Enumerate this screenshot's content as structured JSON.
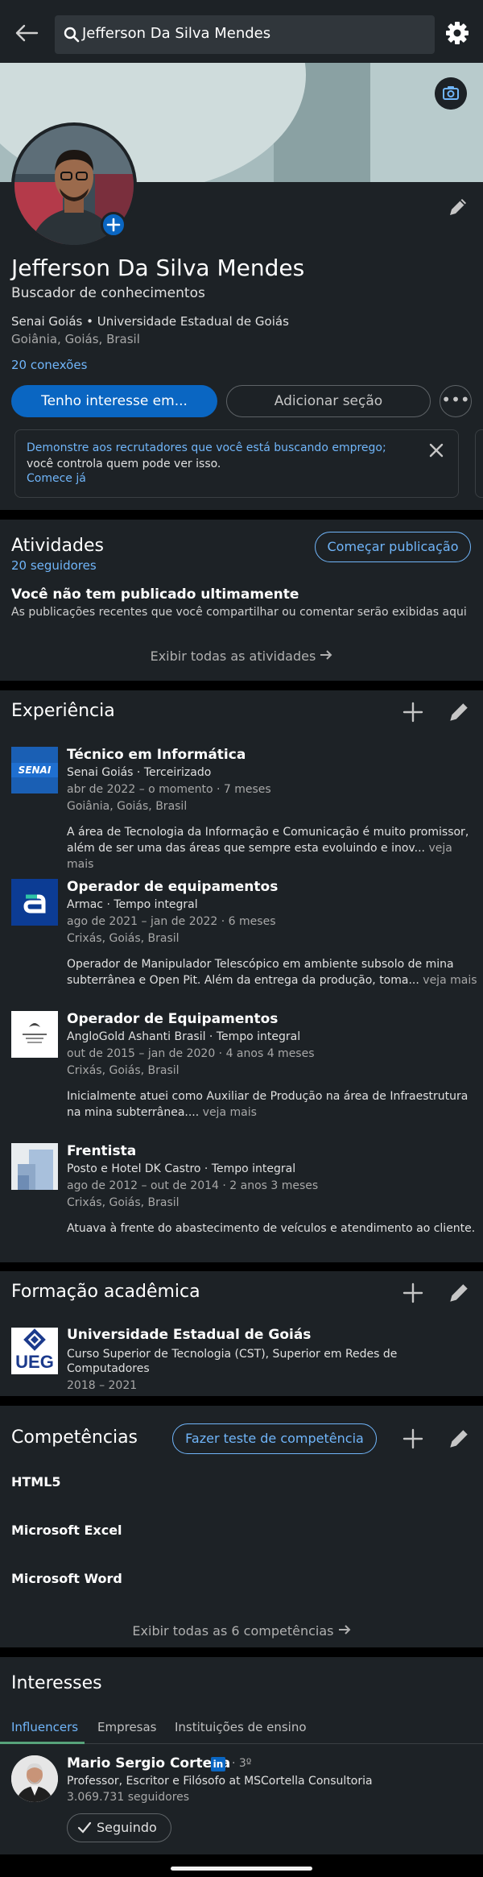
{
  "search": {
    "query": "Jefferson Da Silva Mendes"
  },
  "profile": {
    "name": "Jefferson Da Silva Mendes",
    "headline": "Buscador de conhecimentos",
    "education_line": "Senai Goiás • Universidade Estadual de Goiás",
    "location": "Goiânia, Goiás, Brasil",
    "connections": "20 conexões",
    "open_button": "Tenho interesse em...",
    "add_section_button": "Adicionar seção",
    "more_button": "•••",
    "notice": {
      "text_highlight": "Demonstre aos recrutadores que você está buscando emprego;",
      "text_rest": "você controla quem pode ver isso.",
      "link": "Comece já"
    }
  },
  "activity": {
    "title": "Atividades",
    "followers": "20 seguidores",
    "start_post_button": "Começar publicação",
    "empty_title": "Você não tem publicado ultimamente",
    "empty_desc": "As publicações recentes que você compartilhar ou comentar serão exibidas aqui",
    "show_all": "Exibir todas as atividades"
  },
  "experience": {
    "title": "Experiência",
    "items": [
      {
        "logo_label": "SENAI",
        "title": "Técnico em Informática",
        "company": "Senai Goiás · Terceirizado",
        "dates": "abr de 2022 – o momento · 7 meses",
        "location": "Goiânia, Goiás, Brasil",
        "description": "A área de Tecnologia da Informação e Comunicação é muito promissor, além de ser uma das áreas que sempre esta evoluindo e inov...",
        "more": "veja mais"
      },
      {
        "logo_label": "a",
        "title": "Operador de equipamentos",
        "company": "Armac · Tempo integral",
        "dates": "ago de 2021 – jan de 2022 · 6 meses",
        "location": "Crixás, Goiás, Brasil",
        "description": "Operador de Manipulador Telescópico em ambiente subsolo de mina subterrânea e Open Pit. Além da entrega da produção, toma...",
        "more": "veja mais"
      },
      {
        "logo_label": "AngloGold Ashanti",
        "title": "Operador de Equipamentos",
        "company": "AngloGold Ashanti Brasil · Tempo integral",
        "dates": "out de 2015 – jan de 2020 · 4 anos 4 meses",
        "location": "Crixás, Goiás, Brasil",
        "description": "Inicialmente atuei como Auxiliar de Produção na área de Infraestrutura na mina subterrânea....",
        "more": "veja mais"
      },
      {
        "logo_label": "",
        "title": "Frentista",
        "company": "Posto e Hotel DK Castro · Tempo integral",
        "dates": "ago de 2012 – out de 2014 · 2 anos 3 meses",
        "location": "Crixás, Goiás, Brasil",
        "description": "Atuava à frente do abastecimento de veículos e atendimento ao cliente.",
        "more": ""
      }
    ]
  },
  "education": {
    "title": "Formação acadêmica",
    "school": "Universidade Estadual de Goiás",
    "logo_label": "UEG",
    "degree": "Curso Superior de Tecnologia (CST), Superior em Redes de Computadores",
    "years": "2018 – 2021"
  },
  "skills": {
    "title": "Competências",
    "test_button": "Fazer teste de competência",
    "items": [
      "HTML5",
      "Microsoft Excel",
      "Microsoft Word"
    ],
    "show_all": "Exibir todas as 6 competências"
  },
  "interests": {
    "title": "Interesses",
    "tabs": [
      "Influencers",
      "Empresas",
      "Instituições de ensino"
    ],
    "person": {
      "name": "Mario Sergio Cortella",
      "badge": "in",
      "degree": "· 3º",
      "headline": "Professor, Escritor e Filósofo at MSCortella Consultoria",
      "followers": "3.069.731 seguidores",
      "follow_button": "Seguindo"
    }
  },
  "colors": {
    "accent": "#70b5f9",
    "primary": "#0a66c2",
    "card": "#1d2226",
    "background": "#000000"
  }
}
